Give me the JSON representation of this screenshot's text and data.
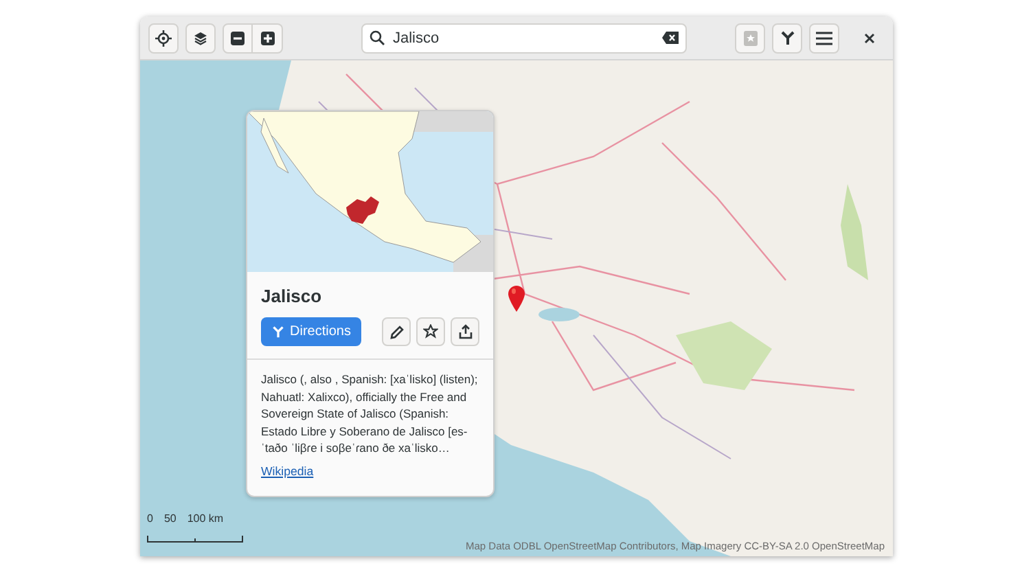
{
  "search": {
    "value": "Jalisco"
  },
  "place": {
    "title": "Jalisco",
    "directions_label": "Directions",
    "description": "Jalisco (, also , Spanish: [xaˈlisko] (listen); Nahuatl: Xalixco), officially the Free and Sovereign State of Jalisco (Spanish: Estado Libre y Soberano de Jalisco [es-ˈtaðo ˈliβɾe i soβeˈɾano ðe xaˈlisko…",
    "link": "Wikipedia"
  },
  "scale": {
    "labels": [
      "0",
      "50",
      "100 km"
    ]
  },
  "attribution": "Map Data ODBL OpenStreetMap Contributors, Map Imagery CC-BY-SA 2.0 OpenStreetMap"
}
